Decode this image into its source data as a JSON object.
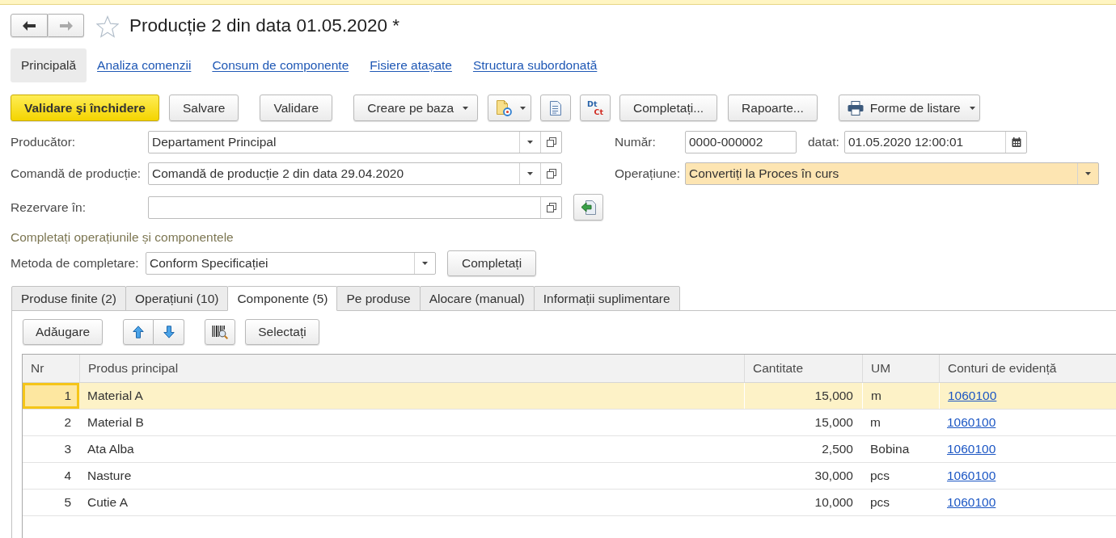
{
  "navigation": {
    "back_disabled": false,
    "forward_disabled": true
  },
  "header": {
    "title": "Producție 2 din data 01.05.2020 *",
    "favorite": false
  },
  "sections": [
    {
      "label": "Principală",
      "selected": true
    },
    {
      "label": "Analiza comenzii",
      "selected": false
    },
    {
      "label": "Consum de componente",
      "selected": false
    },
    {
      "label": "Fisiere atașate",
      "selected": false
    },
    {
      "label": "Structura subordonată",
      "selected": false
    }
  ],
  "command_bar": {
    "post_and_close": "Validare şi închidere",
    "save": "Salvare",
    "post": "Validare",
    "create_based_on": "Creare pe baza",
    "postings": {
      "debit": "Dt",
      "credit": "Ct"
    },
    "fill": "Completați...",
    "reports": "Rapoarte...",
    "print_forms": "Forme de listare"
  },
  "form": {
    "producer": {
      "label": "Producător:",
      "value": "Departament Principal"
    },
    "number": {
      "label": "Număr:",
      "value": "0000-000002"
    },
    "date": {
      "label": "datat:",
      "value": "01.05.2020 12:00:01"
    },
    "production_order": {
      "label": "Comandă de producție:",
      "value": "Comandă de producție 2 din data 29.04.2020"
    },
    "operation": {
      "label": "Operațiune:",
      "value": "Convertiți la Proces în curs"
    },
    "reserve_in": {
      "label": "Rezervare în:"
    },
    "fill_group": {
      "title": "Completați operațiunile și componentele",
      "method_label": "Metoda de completare:",
      "method_value": "Conform Specificației",
      "button": "Completați"
    }
  },
  "tabs": [
    {
      "label": "Produse finite (2)",
      "selected": false
    },
    {
      "label": "Operațiuni (10)",
      "selected": false
    },
    {
      "label": "Componente (5)",
      "selected": true
    },
    {
      "label": "Pe produse",
      "selected": false
    },
    {
      "label": "Alocare (manual)",
      "selected": false
    },
    {
      "label": "Informații suplimentare",
      "selected": false
    }
  ],
  "table_toolbar": {
    "add": "Adăugare",
    "select": "Selectați"
  },
  "table": {
    "columns": [
      "Nr",
      "Produs principal",
      "Cantitate",
      "UM",
      "Conturi de evidență"
    ],
    "rows": [
      {
        "nr": "1",
        "product": "Material A",
        "quantity": "15,000",
        "unit": "m",
        "account": "1060100",
        "selected": true
      },
      {
        "nr": "2",
        "product": "Material B",
        "quantity": "15,000",
        "unit": "m",
        "account": "1060100",
        "selected": false
      },
      {
        "nr": "3",
        "product": "Ata Alba",
        "quantity": "2,500",
        "unit": "Bobina",
        "account": "1060100",
        "selected": false
      },
      {
        "nr": "4",
        "product": "Nasture",
        "quantity": "30,000",
        "unit": "pcs",
        "account": "1060100",
        "selected": false
      },
      {
        "nr": "5",
        "product": "Cutie A",
        "quantity": "10,000",
        "unit": "pcs",
        "account": "1060100",
        "selected": false
      }
    ]
  }
}
